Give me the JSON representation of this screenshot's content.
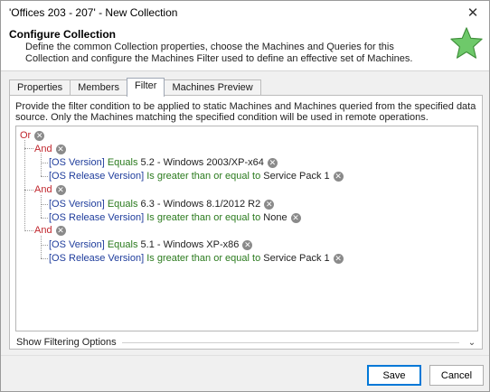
{
  "window": {
    "title": "'Offices 203 - 207' - New Collection",
    "close_icon": "close-icon"
  },
  "header": {
    "title": "Configure Collection",
    "description": "Define the common Collection properties, choose the Machines and Queries for this Collection and configure the Machines Filter used to define an effective set of Machines.",
    "star_icon": "star-icon",
    "star_color": "#6ec96a"
  },
  "tabs": [
    {
      "label": "Properties"
    },
    {
      "label": "Members"
    },
    {
      "label": "Filter"
    },
    {
      "label": "Machines Preview"
    }
  ],
  "active_tab": "Filter",
  "filter": {
    "intro": "Provide the filter condition to be applied to static Machines and Machines queried from the specified data source. Only the Machines matching the specified condition will be used in remote operations.",
    "root": "Or",
    "groups": [
      {
        "op": "And",
        "conditions": [
          {
            "field": "[OS Version]",
            "cmp": "Equals",
            "value": "5.2 - Windows 2003/XP-x64"
          },
          {
            "field": "[OS Release Version]",
            "cmp": "Is greater than or equal to",
            "value": "Service Pack 1"
          }
        ]
      },
      {
        "op": "And",
        "conditions": [
          {
            "field": "[OS Version]",
            "cmp": "Equals",
            "value": "6.3 - Windows 8.1/2012 R2"
          },
          {
            "field": "[OS Release Version]",
            "cmp": "Is greater than or equal to",
            "value": "None"
          }
        ]
      },
      {
        "op": "And",
        "conditions": [
          {
            "field": "[OS Version]",
            "cmp": "Equals",
            "value": "5.1 - Windows XP-x86"
          },
          {
            "field": "[OS Release Version]",
            "cmp": "Is greater than or equal to",
            "value": "Service Pack 1"
          }
        ]
      }
    ],
    "options_label": "Show Filtering Options"
  },
  "buttons": {
    "save": "Save",
    "cancel": "Cancel"
  },
  "colors": {
    "operator": "#c0262d",
    "field": "#1f3d9c",
    "comparison": "#2a7a1d",
    "accent": "#0078d7"
  }
}
